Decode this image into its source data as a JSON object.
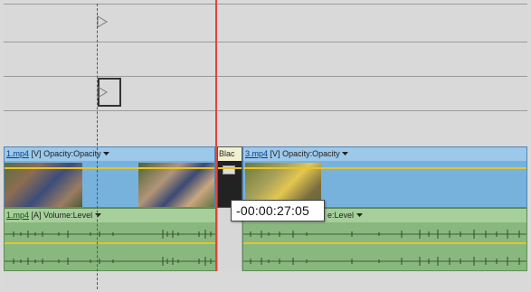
{
  "video_track": {
    "clip1": {
      "name": "1.mp4",
      "tag": "[V]",
      "prop_label": "Opacity:",
      "prop_value": "Opacity",
      "dropdown_icon": "triangle-down"
    },
    "black_clip": {
      "label": "Blac"
    },
    "clip3": {
      "name": "3.mp4",
      "tag": "[V]",
      "prop_label": "Opacity:",
      "prop_value": "Opacity",
      "dropdown_icon": "triangle-down"
    }
  },
  "audio_track": {
    "clip1": {
      "name": "1.mp4",
      "tag": "[A]",
      "prop_label": "Volume:",
      "prop_value": "Level",
      "dropdown_icon": "triangle-down"
    },
    "clip3": {
      "visible_label": "e:Level"
    }
  },
  "tooltip": {
    "timecode": "-00:00:27:05"
  },
  "colors": {
    "video_clip": "#77b2dd",
    "audio_clip": "#89b87e",
    "playhead": "#e0453a",
    "keyframe_line": "#e6c42a"
  }
}
